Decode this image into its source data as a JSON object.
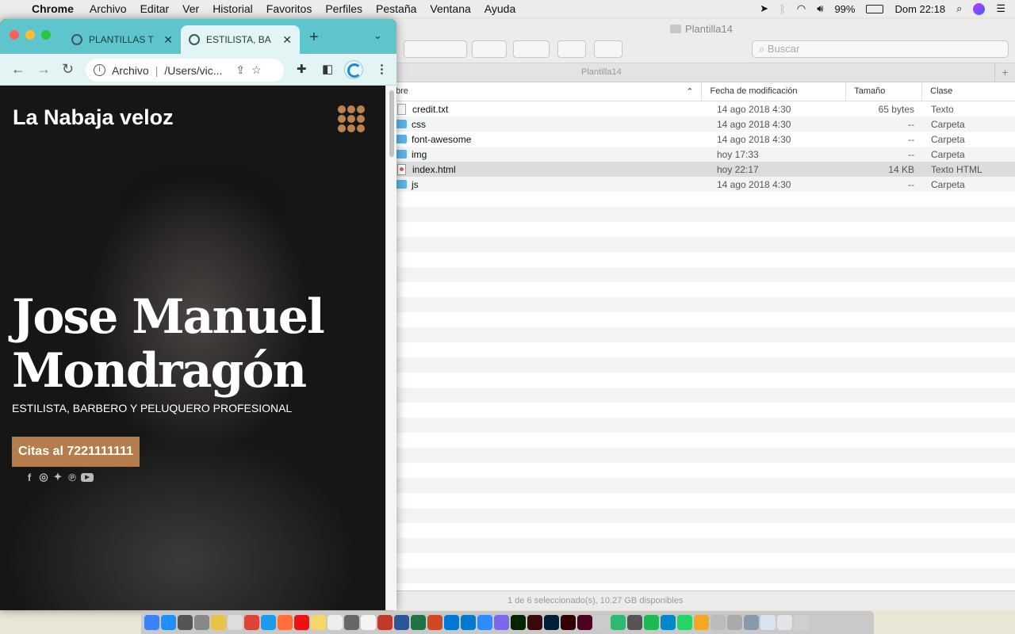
{
  "menubar": {
    "app": "Chrome",
    "items": [
      "Archivo",
      "Editar",
      "Ver",
      "Historial",
      "Favoritos",
      "Perfiles",
      "Pestaña",
      "Ventana",
      "Ayuda"
    ],
    "battery": "99%",
    "clock": "Dom 22:18"
  },
  "chrome": {
    "tabs": [
      {
        "title": "PLANTILLAS T",
        "active": false
      },
      {
        "title": "ESTILISTA, BA",
        "active": true
      }
    ],
    "address": {
      "scheme": "Archivo",
      "url": "/Users/vic..."
    },
    "page": {
      "brand": "La Nabaja veloz",
      "hero_name_line1": "Jose Manuel",
      "hero_name_line2": "Mondragón",
      "subtitle": "ESTILISTA, BARBERO Y PELUQUERO PROFESIONAL",
      "cta": "Citas al 7221111111",
      "accent": "#b57d4b"
    },
    "tabstrip_color": "#5ec5cd"
  },
  "finder": {
    "title": "Plantilla14",
    "search_placeholder": "Buscar",
    "path_label": "Plantilla14",
    "columns": [
      "bre",
      "Fecha de modificación",
      "Tamaño",
      "Clase"
    ],
    "files": [
      {
        "name": "credit.txt",
        "date": "14 ago 2018 4:30",
        "size": "65 bytes",
        "kind": "Texto",
        "icon": "doc",
        "selected": false
      },
      {
        "name": "css",
        "date": "14 ago 2018 4:30",
        "size": "--",
        "kind": "Carpeta",
        "icon": "folder",
        "selected": false
      },
      {
        "name": "font-awesome",
        "date": "14 ago 2018 4:30",
        "size": "--",
        "kind": "Carpeta",
        "icon": "folder",
        "selected": false
      },
      {
        "name": "img",
        "date": "hoy 17:33",
        "size": "--",
        "kind": "Carpeta",
        "icon": "folder",
        "selected": false
      },
      {
        "name": "index.html",
        "date": "hoy 22:17",
        "size": "14 KB",
        "kind": "Texto HTML",
        "icon": "html",
        "selected": true
      },
      {
        "name": "js",
        "date": "14 ago 2018 4:30",
        "size": "--",
        "kind": "Carpeta",
        "icon": "folder",
        "selected": false
      }
    ],
    "status": "1 de 6 seleccionado(s), 10.27 GB disponibles"
  }
}
